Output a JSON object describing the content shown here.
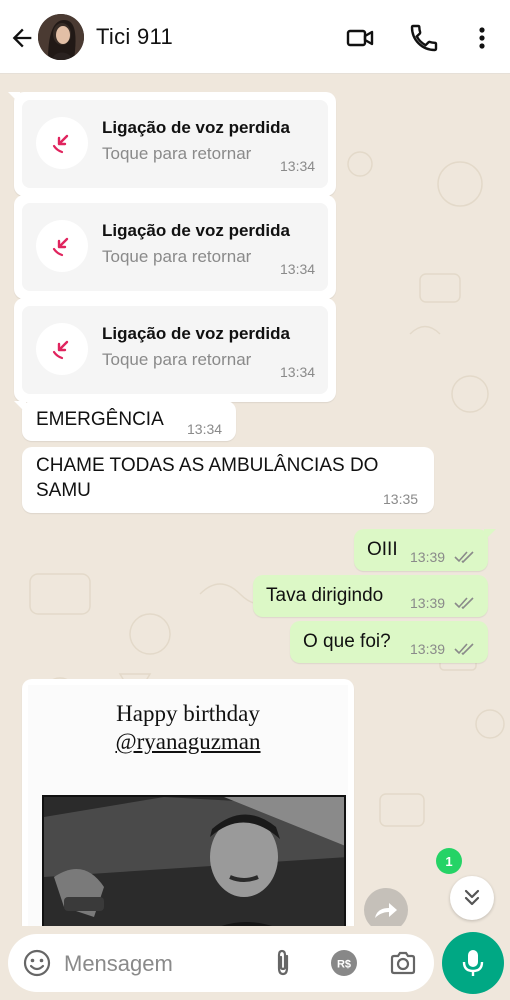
{
  "header": {
    "contact_name": "Tici 911"
  },
  "calls": [
    {
      "title": "Ligação de voz perdida",
      "subtitle": "Toque para retornar",
      "time": "13:34"
    },
    {
      "title": "Ligação de voz perdida",
      "subtitle": "Toque para retornar",
      "time": "13:34"
    },
    {
      "title": "Ligação de voz perdida",
      "subtitle": "Toque para retornar",
      "time": "13:34"
    }
  ],
  "incoming": [
    {
      "text": "EMERGÊNCIA",
      "time": "13:34"
    },
    {
      "text": "CHAME TODAS AS AMBULÂNCIAS DO SAMU",
      "time": "13:35"
    }
  ],
  "outgoing": [
    {
      "text": "OIII",
      "time": "13:39"
    },
    {
      "text": "Tava dirigindo",
      "time": "13:39"
    },
    {
      "text": "O que foi?",
      "time": "13:39"
    }
  ],
  "story": {
    "line1": "Happy birthday",
    "line2": "@ryanaguzman"
  },
  "unread_count": "1",
  "input": {
    "placeholder": "Mensagem"
  },
  "colors": {
    "accent": "#00a884",
    "missed_call": "#e0245e",
    "outgoing_bubble": "#dcf8c6",
    "badge": "#25d366",
    "read_ticks": "#8a8a8a"
  },
  "icons": [
    "back-arrow-icon",
    "video-call-icon",
    "phone-icon",
    "more-vert-icon",
    "missed-call-icon",
    "forward-icon",
    "double-chevron-down-icon",
    "emoji-icon",
    "attach-icon",
    "currency-icon",
    "camera-icon",
    "mic-icon"
  ]
}
